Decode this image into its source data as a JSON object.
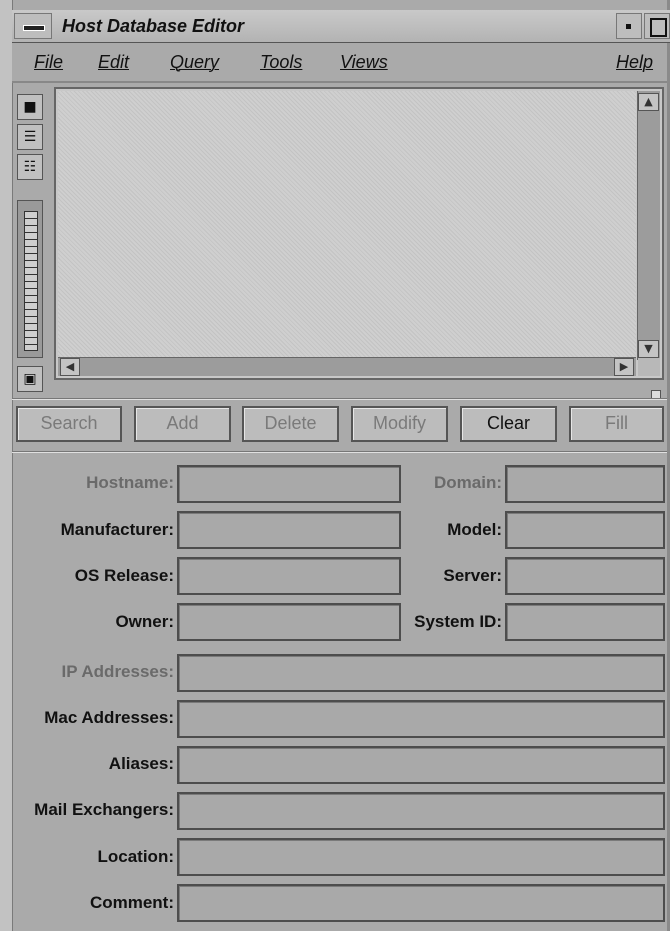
{
  "window": {
    "title": "Host Database Editor"
  },
  "menubar": {
    "items": [
      {
        "label": "File"
      },
      {
        "label": "Edit"
      },
      {
        "label": "Query"
      },
      {
        "label": "Tools"
      },
      {
        "label": "Views"
      },
      {
        "label": "Help"
      }
    ]
  },
  "toolbar": {
    "tools": [
      {
        "icon": "pointer-icon"
      },
      {
        "icon": "list-view-icon"
      },
      {
        "icon": "table-view-icon"
      }
    ],
    "bottom_icon": "overview-icon"
  },
  "actions": {
    "search": "Search",
    "add": "Add",
    "delete": "Delete",
    "modify": "Modify",
    "clear": "Clear",
    "fill": "Fill"
  },
  "form": {
    "hostname": {
      "label": "Hostname:",
      "value": ""
    },
    "domain": {
      "label": "Domain:",
      "value": ""
    },
    "manufacturer": {
      "label": "Manufacturer:",
      "value": ""
    },
    "model": {
      "label": "Model:",
      "value": ""
    },
    "os_release": {
      "label": "OS Release:",
      "value": ""
    },
    "server": {
      "label": "Server:",
      "value": ""
    },
    "owner": {
      "label": "Owner:",
      "value": ""
    },
    "system_id": {
      "label": "System ID:",
      "value": ""
    },
    "ip_addresses": {
      "label": "IP Addresses:",
      "value": ""
    },
    "mac_addresses": {
      "label": "Mac Addresses:",
      "value": ""
    },
    "aliases": {
      "label": "Aliases:",
      "value": ""
    },
    "mail_exchangers": {
      "label": "Mail Exchangers:",
      "value": ""
    },
    "location": {
      "label": "Location:",
      "value": ""
    },
    "comment": {
      "label": "Comment:",
      "value": ""
    }
  },
  "colors": {
    "background": "#aaaaaa",
    "field": "#a9a9a9",
    "disabled_text": "#7a7a7a"
  }
}
